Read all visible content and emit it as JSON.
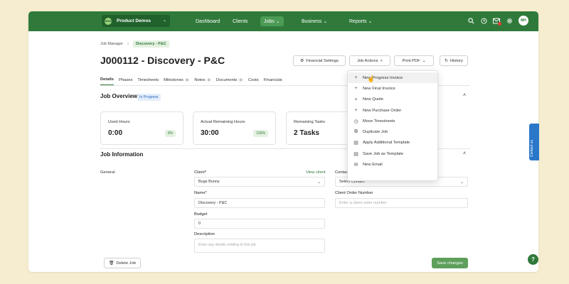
{
  "org": {
    "logo_text": "DEMO",
    "name": "Product Demos"
  },
  "nav": {
    "items": [
      {
        "label": "Dashboard"
      },
      {
        "label": "Clients"
      },
      {
        "label": "Jobs"
      },
      {
        "label": "Business"
      },
      {
        "label": "Reports"
      }
    ]
  },
  "user": {
    "initials": "MH"
  },
  "breadcrumb": {
    "root": "Job Manager",
    "current": "Discovery - P&C"
  },
  "job": {
    "title": "J000112 - Discovery - P&C"
  },
  "actions": {
    "financial_settings": "Financial Settings",
    "job_actions": "Job Actions",
    "print_pdf": "Print PDF",
    "history": "History"
  },
  "tabs": [
    {
      "label": "Details"
    },
    {
      "label": "Phases"
    },
    {
      "label": "Timesheets"
    },
    {
      "label": "Milestones",
      "count": "0"
    },
    {
      "label": "Notes",
      "count": "0"
    },
    {
      "label": "Documents",
      "count": "0"
    },
    {
      "label": "Costs"
    },
    {
      "label": "Financials"
    }
  ],
  "overview": {
    "title": "Job Overview",
    "status": "In Progress",
    "cards": [
      {
        "label": "Used Hours",
        "value": "0:00",
        "badge": "0%"
      },
      {
        "label": "Actual Remaining Hours",
        "value": "30:00",
        "badge": "100%"
      },
      {
        "label": "Remaining Tasks",
        "value": "2 Tasks"
      }
    ]
  },
  "info": {
    "title": "Job Information",
    "section_label": "General",
    "client_label": "Client*",
    "view_client": "View client",
    "client_value": "Bugs Bunny",
    "contact_label": "Contact",
    "contact_value": "Select Contact",
    "name_label": "Name*",
    "name_value": "Discovery - P&C",
    "order_label": "Client Order Number",
    "order_placeholder": "Enter a client order number",
    "budget_label": "Budget",
    "budget_value": "0",
    "desc_label": "Description",
    "desc_placeholder": "Enter any details relating to this job"
  },
  "footer": {
    "delete": "Delete Job",
    "save": "Save changes"
  },
  "dropdown": {
    "items": [
      {
        "label": "New Progress Invoice",
        "icon": "plus-icon"
      },
      {
        "label": "New Final Invoice",
        "icon": "plus-icon"
      },
      {
        "label": "New Quote",
        "icon": "plus-icon"
      },
      {
        "label": "New Purchase Order",
        "icon": "plus-icon"
      },
      {
        "label": "Move Timesheets",
        "icon": "clock-icon"
      },
      {
        "label": "Duplicate Job",
        "icon": "copy-icon"
      },
      {
        "label": "Apply Additional Template",
        "icon": "template-icon"
      },
      {
        "label": "Save Job as Template",
        "icon": "template-icon"
      },
      {
        "label": "New Email",
        "icon": "email-icon"
      }
    ]
  },
  "side": {
    "contact_us": "Contact us",
    "help": "?"
  },
  "colors": {
    "brand": "#2f7a3a",
    "background": "#f6ecd0",
    "accent_blue": "#2a77c9"
  }
}
